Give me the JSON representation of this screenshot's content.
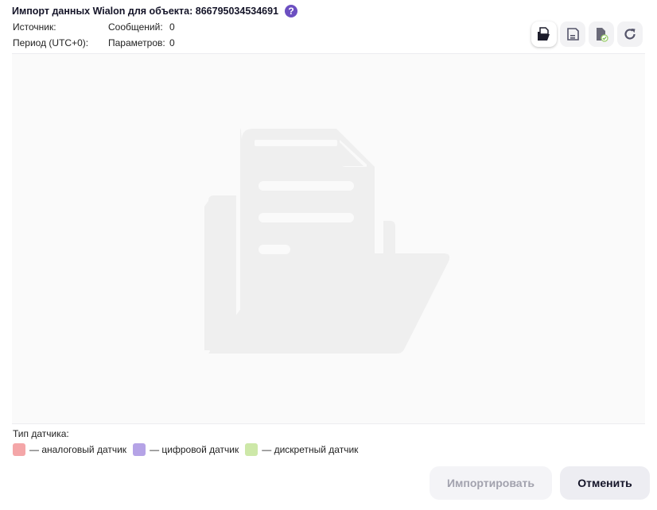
{
  "header": {
    "title": "Импорт данных Wialon для объекта: 866795034534691",
    "help_glyph": "?"
  },
  "info": {
    "source_label": "Источник:",
    "source_value": "",
    "period_label": "Период (UTC+0):",
    "period_value": "",
    "messages_label": "Сообщений:",
    "messages_value": "0",
    "params_label": "Параметров:",
    "params_value": "0"
  },
  "toolbar": {
    "icons": [
      "folder-open-icon",
      "save-icon",
      "file-check-icon",
      "refresh-icon"
    ],
    "active": "folder-open-icon"
  },
  "empty_state": {
    "icon": "file-folder-illustration"
  },
  "legend": {
    "title": "Тип датчика:",
    "items": [
      {
        "label": "— аналоговый датчик",
        "color": "#f4a6a8"
      },
      {
        "label": "— цифровой датчик",
        "color": "#b5a3e6"
      },
      {
        "label": "— дискретный датчик",
        "color": "#cde8a8"
      }
    ]
  },
  "actions": {
    "import_label": "Импортировать",
    "cancel_label": "Отменить"
  },
  "colors": {
    "accent": "#6c4fc1",
    "illustration": "#efefef"
  }
}
